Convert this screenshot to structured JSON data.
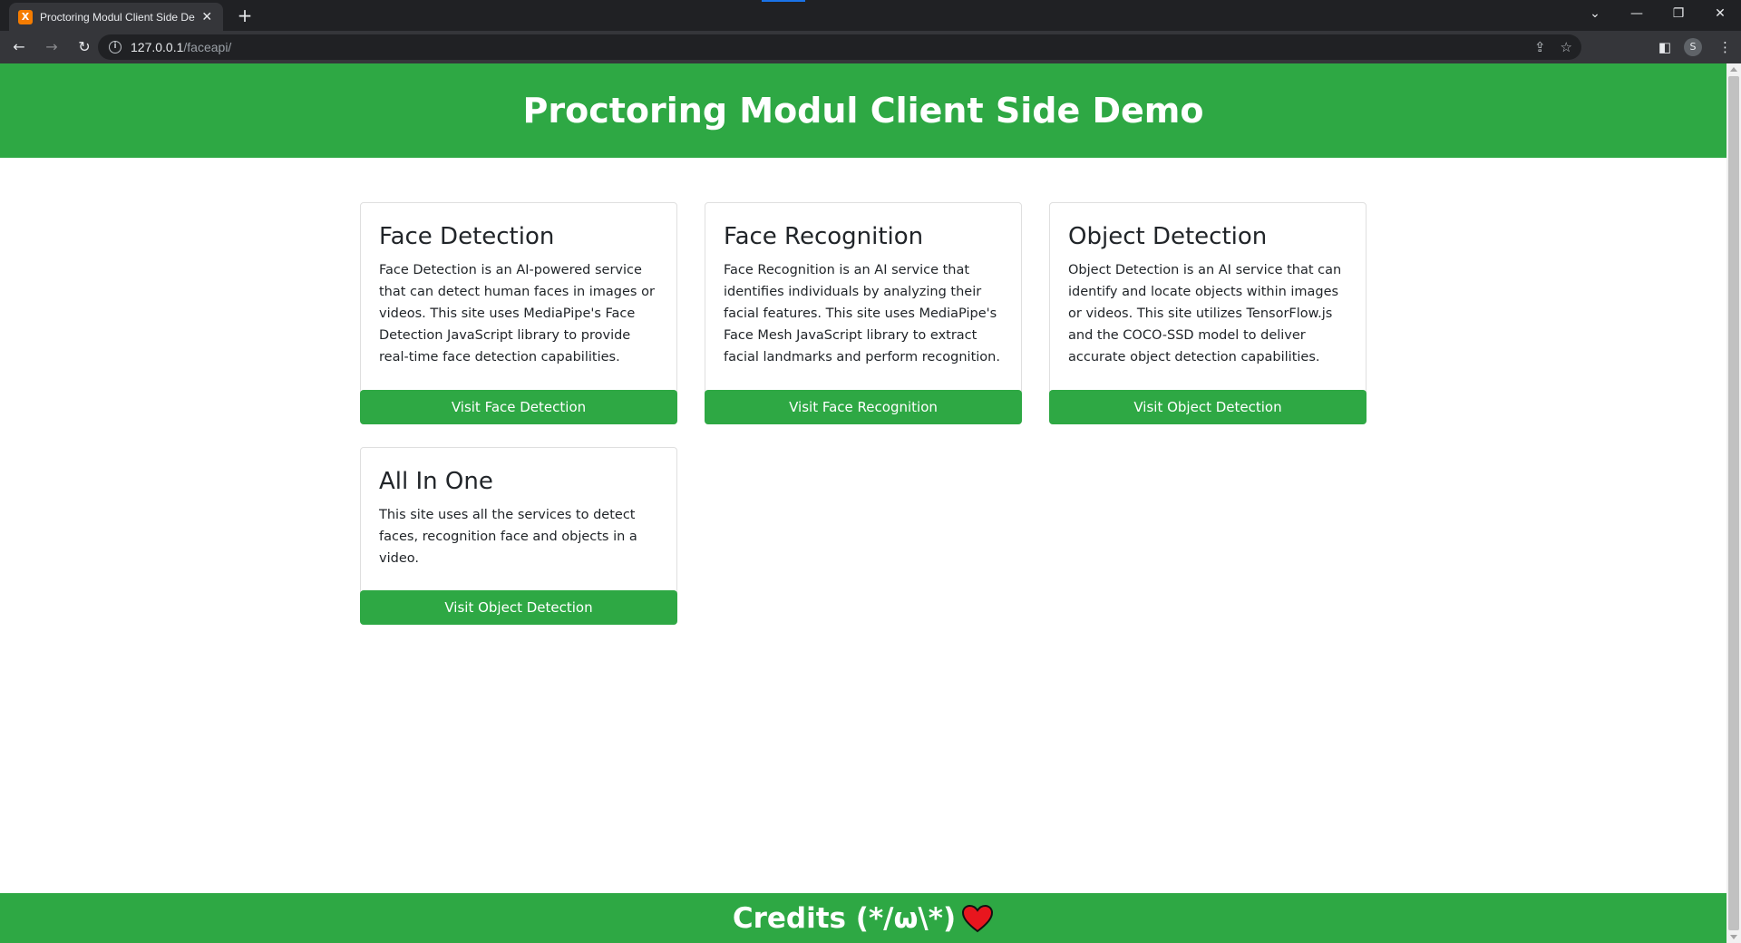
{
  "browser": {
    "tab_title": "Proctoring Modul Client Side Demo",
    "tab_favicon_letter": "XA",
    "url_host": "127.0.0.1",
    "url_path": "/faceapi/",
    "profile_initial": "S",
    "accent_color": "#1a73e8"
  },
  "page": {
    "title": "Proctoring Modul Client Side Demo",
    "brand_color": "#2ea844",
    "cards": [
      {
        "title": "Face Detection",
        "text": "Face Detection is an AI-powered service that can detect human faces in images or videos. This site uses MediaPipe's Face Detection JavaScript library to provide real-time face detection capabilities.",
        "button": "Visit Face Detection"
      },
      {
        "title": "Face Recognition",
        "text": "Face Recognition is an AI service that identifies individuals by analyzing their facial features. This site uses MediaPipe's Face Mesh JavaScript library to extract facial landmarks and perform recognition.",
        "button": "Visit Face Recognition"
      },
      {
        "title": "Object Detection",
        "text": "Object Detection is an AI service that can identify and locate objects within images or videos. This site utilizes TensorFlow.js and the COCO-SSD model to deliver accurate object detection capabilities.",
        "button": "Visit Object Detection"
      },
      {
        "title": "All In One",
        "text": "This site uses all the services to detect faces, recognition face and objects in a video.",
        "button": "Visit Object Detection"
      }
    ],
    "footer_text": "Credits (*/ω\\*)",
    "footer_icon": "heart-icon"
  }
}
